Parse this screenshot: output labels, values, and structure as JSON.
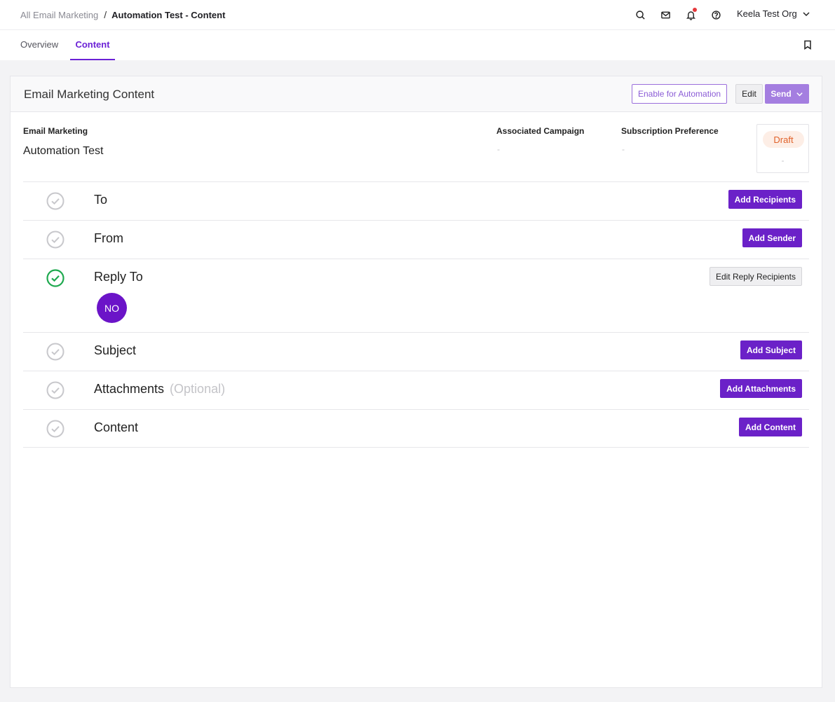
{
  "breadcrumb": {
    "parent": "All Email Marketing",
    "separator": "/",
    "current": "Automation Test - Content"
  },
  "header": {
    "icons": [
      "search-icon",
      "mail-icon",
      "bell-icon",
      "help-icon"
    ],
    "org_name": "Keela Test Org"
  },
  "tabs": [
    {
      "label": "Overview",
      "active": false
    },
    {
      "label": "Content",
      "active": true
    }
  ],
  "card": {
    "title": "Email Marketing Content",
    "buttons": {
      "enable": "Enable for Automation",
      "edit": "Edit",
      "send": "Send"
    }
  },
  "meta": {
    "email_marketing_label": "Email Marketing",
    "email_marketing_value": "Automation Test",
    "campaign_label": "Associated Campaign",
    "campaign_value": "-",
    "subscription_label": "Subscription Preference",
    "subscription_value": "-",
    "status": "Draft",
    "status_sub": "-"
  },
  "steps": [
    {
      "label": "To",
      "done": false,
      "button": "Add Recipients",
      "button_style": "primary"
    },
    {
      "label": "From",
      "done": false,
      "button": "Add Sender",
      "button_style": "primary"
    },
    {
      "label": "Reply To",
      "done": true,
      "button": "Edit Reply Recipients",
      "button_style": "secondary",
      "avatar": "NO"
    },
    {
      "label": "Subject",
      "done": false,
      "button": "Add Subject",
      "button_style": "primary"
    },
    {
      "label": "Attachments",
      "optional": "(Optional)",
      "done": false,
      "button": "Add Attachments",
      "button_style": "primary"
    },
    {
      "label": "Content",
      "done": false,
      "button": "Add Content",
      "button_style": "primary"
    }
  ],
  "colors": {
    "accent": "#6b21c8",
    "done": "#1fa94f",
    "pending": "#c8c8cc",
    "draft": "#e0622a"
  }
}
